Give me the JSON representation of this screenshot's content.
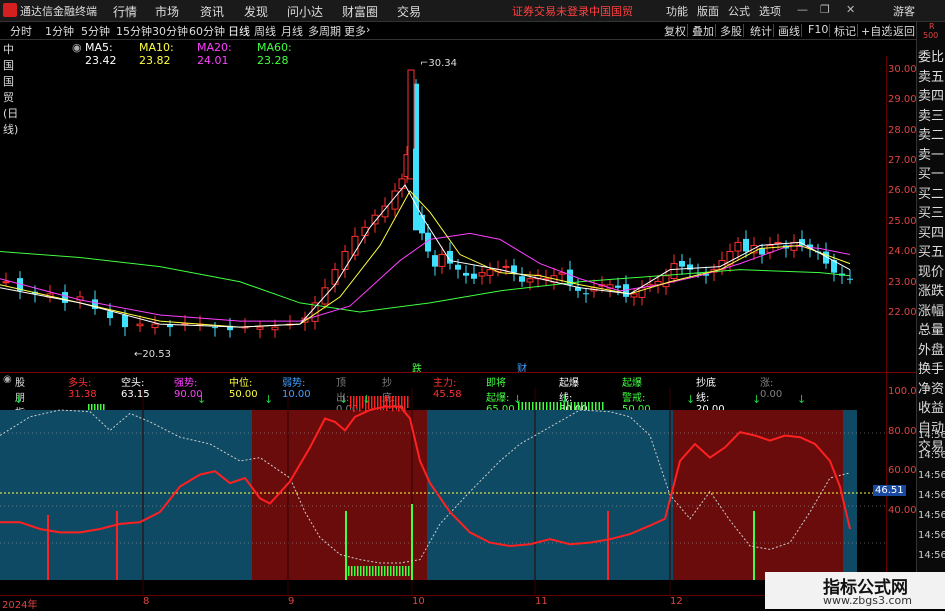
{
  "titlebar": {
    "app_name": "通达信金融终端",
    "menus": [
      "行情",
      "市场",
      "资讯",
      "发现",
      "问小达",
      "财富圈",
      "交易"
    ],
    "warning": "证券交易未登录",
    "stock": "中国国贸",
    "right_menus": [
      "功能",
      "版面",
      "公式",
      "选项"
    ],
    "user": "游客"
  },
  "periodbar": {
    "periods": [
      "分时",
      "1分钟",
      "5分钟",
      "15分钟",
      "30分钟",
      "60分钟",
      "日线",
      "周线",
      "月线",
      "多周期",
      "更多"
    ],
    "active": "日线",
    "tools": [
      "复权",
      "叠加",
      "多股",
      "统计",
      "画线",
      "F10",
      "标记",
      "+自选",
      "返回"
    ]
  },
  "legend": {
    "name": "中国国贸(日线)",
    "ma5": "MA5: 23.42",
    "ma10": "MA10: 23.82",
    "ma20": "MA20: 24.01",
    "ma60": "MA60: 23.28",
    "colors": {
      "ma5": "#ffffff",
      "ma10": "#ffff40",
      "ma20": "#ff40ff",
      "ma60": "#40ff40"
    }
  },
  "price_axis": [
    "30.00",
    "29.00",
    "28.00",
    "27.00",
    "26.00",
    "25.00",
    "24.00",
    "23.00",
    "22.00"
  ],
  "annotations": {
    "high": "30.34",
    "low": "20.53",
    "die": "跌",
    "cai": "财"
  },
  "right_panel": {
    "top": "R",
    "top2": "500",
    "items": [
      "委比",
      "卖五",
      "卖四",
      "卖三",
      "卖二",
      "卖一",
      "买一",
      "买二",
      "买三",
      "买四",
      "买五",
      "现价",
      "涨跌",
      "涨幅",
      "总量",
      "外盘",
      "换手",
      "净资",
      "收益",
      "自动",
      "交易"
    ],
    "times": [
      "14:56",
      "14:56",
      "14:56",
      "14:56",
      "14:56",
      "14:56",
      "14:56"
    ]
  },
  "indicator": {
    "name": "股朋指标网",
    "items": [
      {
        "label": "多头: 31.38",
        "color": "#ff3030"
      },
      {
        "label": "空头: 63.15",
        "color": "#ffffff"
      },
      {
        "label": "强势: 90.00",
        "color": "#ff40ff"
      },
      {
        "label": "中位: 50.00",
        "color": "#ffff40"
      },
      {
        "label": "弱势: 10.00",
        "color": "#40a0ff"
      },
      {
        "label": "顶出: 0.00",
        "color": "#808080"
      },
      {
        "label": "抄底: 0.00",
        "color": "#808080"
      },
      {
        "label": "主力: 45.58",
        "color": "#ff3030"
      },
      {
        "label": "即将起爆: 65.00",
        "color": "#40ff40"
      },
      {
        "label": "起爆线: 80.00",
        "color": "#ffffff"
      },
      {
        "label": "起爆警戒: 50.00",
        "color": "#40ff40"
      },
      {
        "label": "抄底线: 20.00",
        "color": "#ffffff"
      },
      {
        "label": "涨: 0.00",
        "color": "#808080"
      }
    ],
    "axis": [
      "100.00",
      "80.00",
      "60.00",
      "40.00"
    ],
    "current": "46.51"
  },
  "dates": [
    "2024年",
    "8",
    "9",
    "10",
    "11",
    "12"
  ],
  "watermark": {
    "title": "指标公式网",
    "url": "www.zbgs3.com"
  }
}
